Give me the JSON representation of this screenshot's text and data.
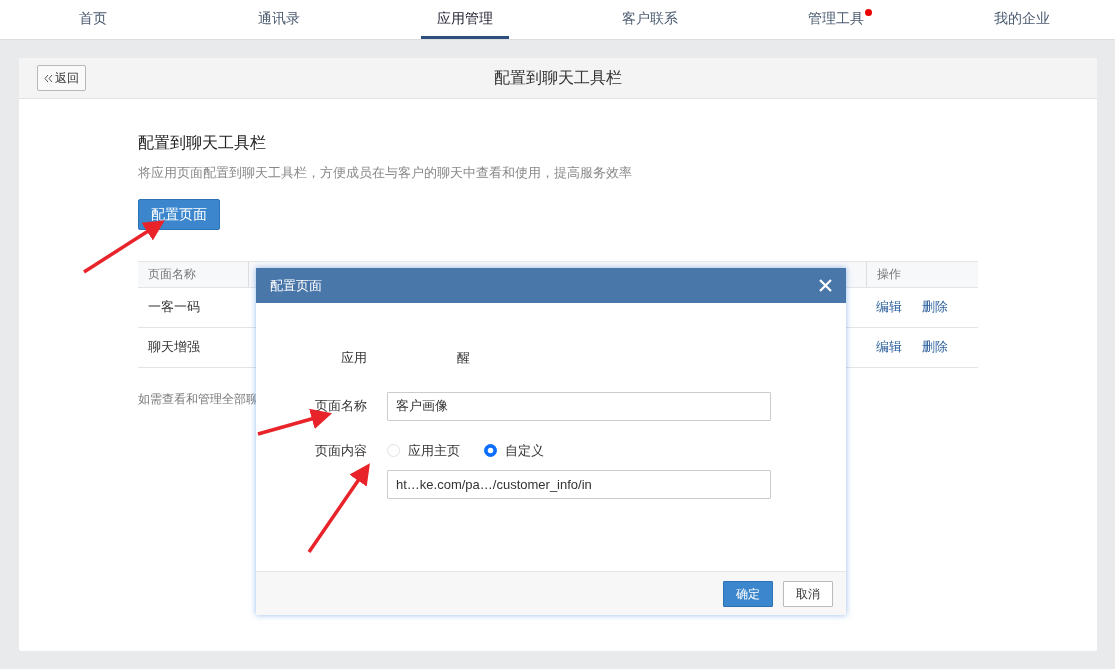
{
  "nav": {
    "tabs": [
      {
        "label": "首页",
        "selected": false,
        "badge": false
      },
      {
        "label": "通讯录",
        "selected": false,
        "badge": false
      },
      {
        "label": "应用管理",
        "selected": true,
        "badge": false
      },
      {
        "label": "客户联系",
        "selected": false,
        "badge": false
      },
      {
        "label": "管理工具",
        "selected": false,
        "badge": true
      },
      {
        "label": "我的企业",
        "selected": false,
        "badge": false
      }
    ]
  },
  "header": {
    "back_button": "返回",
    "title": "配置到聊天工具栏"
  },
  "section": {
    "title": "配置到聊天工具栏",
    "description": "将应用页面配置到聊天工具栏，方便成员在与客户的聊天中查看和使用，提高服务效率",
    "config_button": "配置页面"
  },
  "table": {
    "columns": [
      "页面名称",
      "操作"
    ],
    "rows": [
      {
        "name": "一客一码",
        "actions": [
          "编辑",
          "删除"
        ]
      },
      {
        "name": "聊天增强",
        "actions": [
          "编辑",
          "删除"
        ]
      }
    ]
  },
  "footer_note": "如需查看和管理全部聊",
  "dialog": {
    "title": "配置页面",
    "app_label": "应用",
    "app_name": "醒",
    "name_label": "页面名称",
    "name_value": "客户画像",
    "content_label": "页面内容",
    "options": [
      {
        "label": "应用主页",
        "selected": false
      },
      {
        "label": "自定义",
        "selected": true
      }
    ],
    "url_value": "ht…ke.com/pa…/customer_info/in",
    "ok": "确定",
    "cancel": "取消"
  }
}
